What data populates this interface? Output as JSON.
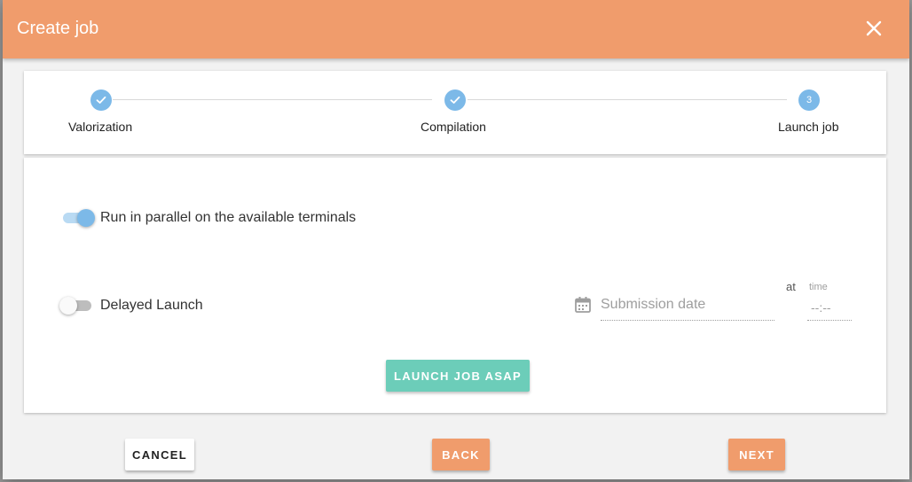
{
  "dialog": {
    "title": "Create job",
    "close_icon": "close-icon"
  },
  "stepper": {
    "steps": [
      {
        "label": "Valorization",
        "state": "completed",
        "icon": "check-icon"
      },
      {
        "label": "Compilation",
        "state": "completed",
        "icon": "check-icon"
      },
      {
        "label": "Launch job",
        "state": "active",
        "number": "3"
      }
    ]
  },
  "options": {
    "parallel": {
      "label": "Run in parallel on the available terminals",
      "enabled": true
    },
    "delayed": {
      "label": "Delayed Launch",
      "enabled": false
    }
  },
  "schedule": {
    "date_placeholder": "Submission date",
    "at_label": "at",
    "time_label": "time",
    "time_placeholder": "--:--"
  },
  "actions": {
    "launch_label": "LAUNCH JOB ASAP",
    "cancel_label": "CANCEL",
    "back_label": "BACK",
    "next_label": "NEXT"
  },
  "colors": {
    "header": "#f09c6c",
    "accent": "#7cb9e8",
    "launch_button": "#6ccdb9"
  }
}
